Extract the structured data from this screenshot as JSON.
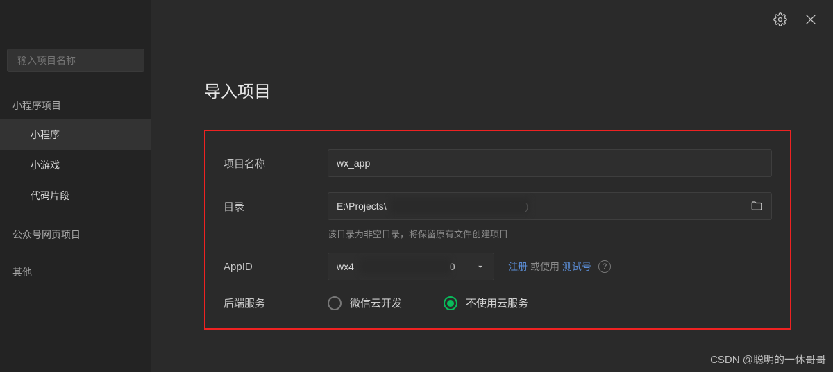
{
  "titlebar": {
    "settings_icon": "gear",
    "close_icon": "close"
  },
  "search": {
    "placeholder": "输入项目名称"
  },
  "sidebar": {
    "section1": {
      "heading": "小程序项目",
      "items": [
        {
          "label": "小程序",
          "active": true
        },
        {
          "label": "小游戏",
          "active": false
        },
        {
          "label": "代码片段",
          "active": false
        }
      ]
    },
    "section2": {
      "heading": "公众号网页项目"
    },
    "section3": {
      "heading": "其他"
    }
  },
  "page": {
    "title": "导入项目"
  },
  "form": {
    "name_label": "项目名称",
    "name_value": "wx_app",
    "dir_label": "目录",
    "dir_value": "E:\\Projects\\",
    "dir_suffix": ")",
    "dir_hint": "该目录为非空目录，将保留原有文件创建项目",
    "appid_label": "AppID",
    "appid_prefix": "wx4",
    "appid_suffix": "0",
    "appid_register": "注册",
    "appid_or": "或使用",
    "appid_test": "测试号",
    "backend_label": "后端服务",
    "backend_options": [
      {
        "label": "微信云开发",
        "checked": false
      },
      {
        "label": "不使用云服务",
        "checked": true
      }
    ]
  },
  "watermark": "CSDN @聪明的一休哥哥"
}
